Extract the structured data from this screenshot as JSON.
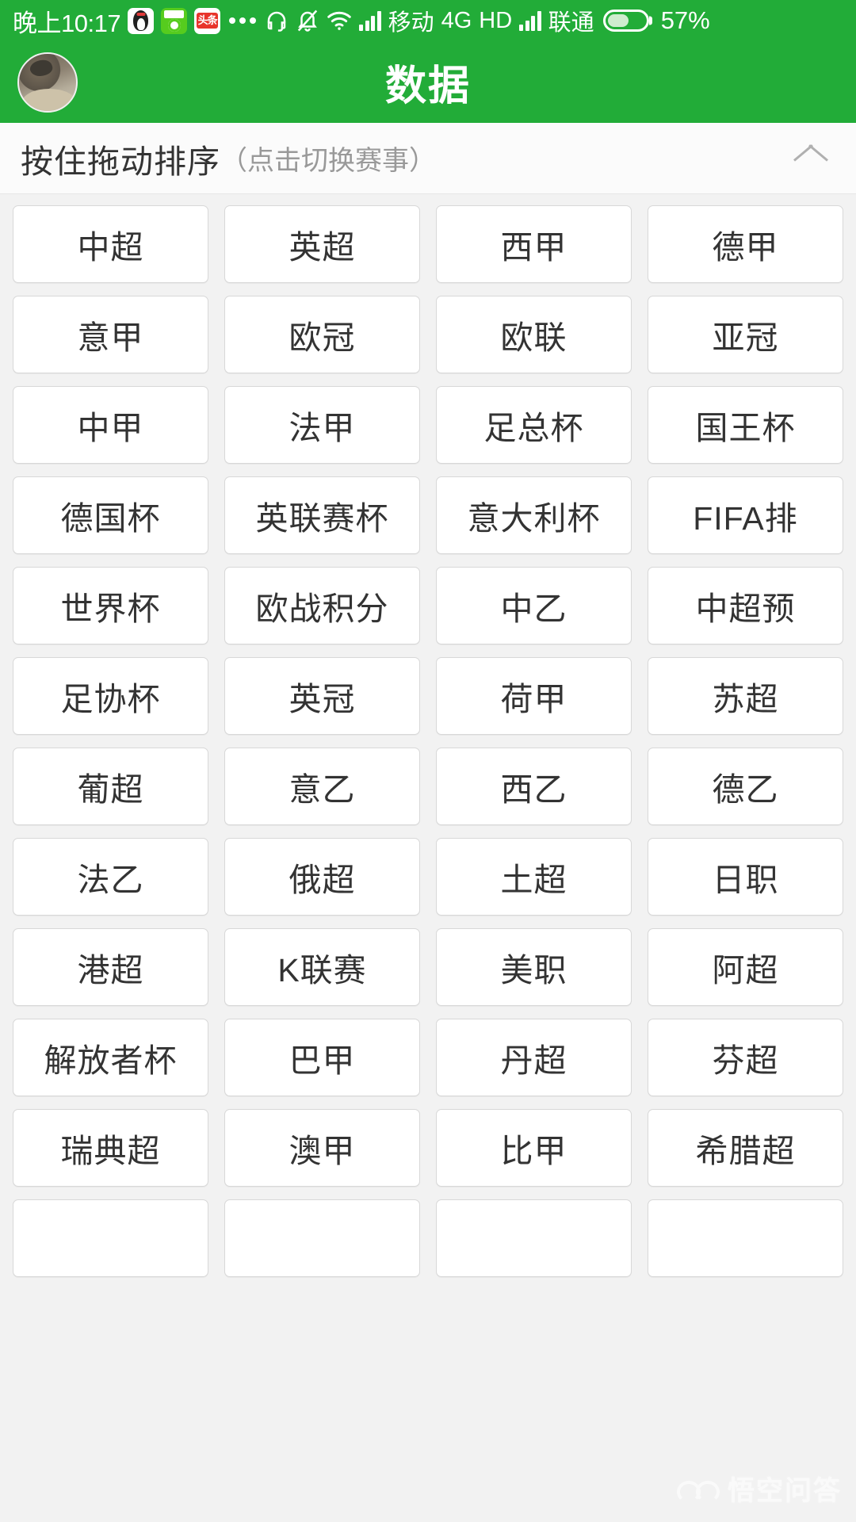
{
  "status_bar": {
    "time": "晚上10:17",
    "app_icons": [
      "qq-icon",
      "football-app-icon",
      "toutiao-icon"
    ],
    "more_dots": "...",
    "headset_icon": "headset-icon",
    "mute_bell_icon": "bell-muted-icon",
    "wifi_icon": "wifi-icon",
    "signal_icon_1": "signal-bars-icon",
    "carrier_1": "移动",
    "network_type": "4G",
    "hd_label": "HD",
    "signal_icon_2": "signal-bars-icon",
    "carrier_2": "联通",
    "battery_icon": "battery-icon",
    "battery_percent": "57%",
    "battery_level": 57,
    "background_color": "#22ac38",
    "foreground_color": "#ffffff"
  },
  "header": {
    "title": "数据",
    "avatar": "user-avatar",
    "background_color": "#22ac38"
  },
  "instruction_bar": {
    "main_text": "按住拖动排序",
    "sub_text": "（点击切换赛事）",
    "collapse_icon": "chevron-up-icon"
  },
  "leagues": [
    "中超",
    "英超",
    "西甲",
    "德甲",
    "意甲",
    "欧冠",
    "欧联",
    "亚冠",
    "中甲",
    "法甲",
    "足总杯",
    "国王杯",
    "德国杯",
    "英联赛杯",
    "意大利杯",
    "FIFA排",
    "世界杯",
    "欧战积分",
    "中乙",
    "中超预",
    "足协杯",
    "英冠",
    "荷甲",
    "苏超",
    "葡超",
    "意乙",
    "西乙",
    "德乙",
    "法乙",
    "俄超",
    "土超",
    "日职",
    "港超",
    "K联赛",
    "美职",
    "阿超",
    "解放者杯",
    "巴甲",
    "丹超",
    "芬超",
    "瑞典超",
    "澳甲",
    "比甲",
    "希腊超",
    "",
    "",
    "",
    ""
  ],
  "watermark": {
    "text": "悟空问答",
    "logo": "wukong-logo"
  },
  "colors": {
    "brand_green": "#22ac38",
    "page_background": "#f2f2f2",
    "cell_background": "#ffffff",
    "cell_border": "#d8d8d8",
    "primary_text": "#333333",
    "secondary_text": "#999999"
  }
}
